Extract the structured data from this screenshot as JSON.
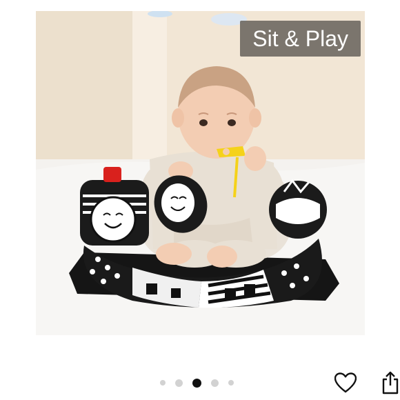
{
  "product_image": {
    "caption": "Sit & Play"
  },
  "carousel": {
    "total": 5,
    "active_index": 3
  },
  "actions": {
    "favorite_icon": "heart-outline-icon",
    "share_icon": "share-icon"
  },
  "colors": {
    "caption_bg": "#6e6862",
    "active_dot": "#111111",
    "inactive_dot": "#d2d2d2"
  }
}
